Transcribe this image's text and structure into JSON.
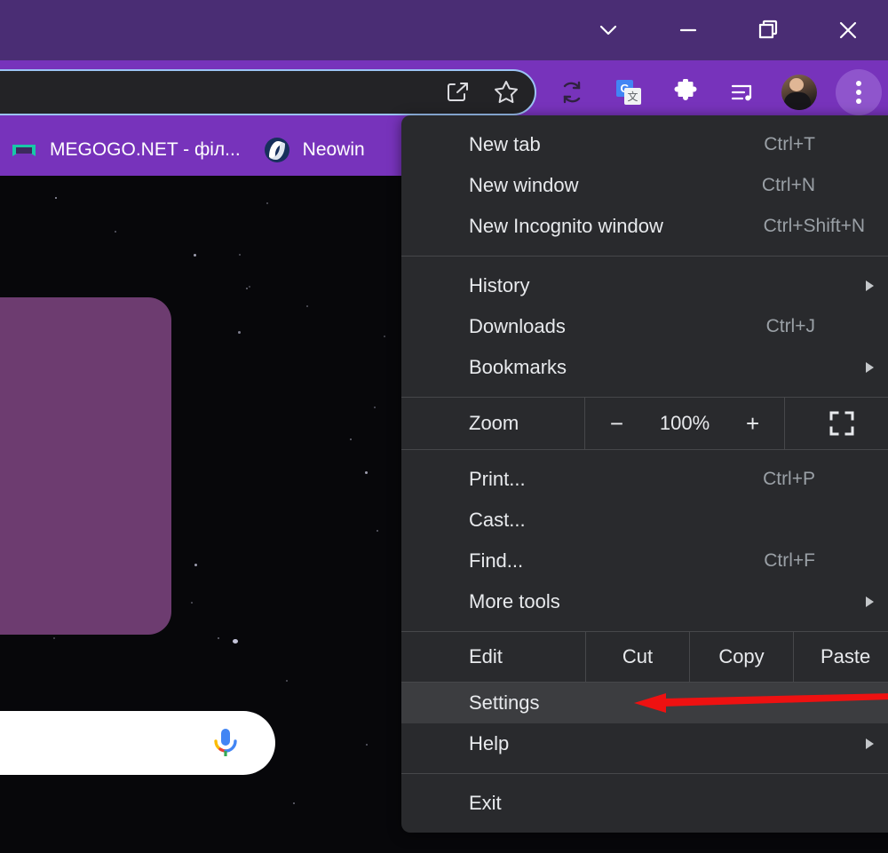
{
  "window": {
    "controls": [
      {
        "name": "chevron-down-icon",
        "label": "Minimize to tab search"
      },
      {
        "name": "minimize-icon",
        "label": "Minimize"
      },
      {
        "name": "restore-icon",
        "label": "Restore"
      },
      {
        "name": "close-icon",
        "label": "Close"
      }
    ],
    "titlebar_color": "#4a2d74",
    "toolbar_color": "#7733bb"
  },
  "toolbar": {
    "omnibox_icons": [
      "share-icon",
      "bookmark-star-icon"
    ],
    "actions": [
      {
        "name": "refresh-sync-icon",
        "label": "Sync"
      },
      {
        "name": "google-translate-icon",
        "label": "Translate"
      },
      {
        "name": "extensions-puzzle-icon",
        "label": "Extensions"
      },
      {
        "name": "media-playlist-icon",
        "label": "Media"
      },
      {
        "name": "avatar",
        "label": "Profile"
      },
      {
        "name": "three-dot-menu-icon",
        "label": "Customize and control Google Chrome"
      }
    ]
  },
  "bookmarks": {
    "items": [
      {
        "label": "MEGOGO.NET - філ...",
        "icon": "megogo-icon",
        "color": "#18c8a8"
      },
      {
        "label": "Neowin",
        "icon": "neowin-icon",
        "color": "#1b3a6b"
      }
    ]
  },
  "menu": {
    "sections": [
      {
        "items": [
          {
            "label": "New tab",
            "accel": "Ctrl+T",
            "submenu": false
          },
          {
            "label": "New window",
            "accel": "Ctrl+N",
            "submenu": false
          },
          {
            "label": "New Incognito window",
            "accel": "Ctrl+Shift+N",
            "submenu": false
          }
        ]
      },
      {
        "items": [
          {
            "label": "History",
            "accel": "",
            "submenu": true
          },
          {
            "label": "Downloads",
            "accel": "Ctrl+J",
            "submenu": false
          },
          {
            "label": "Bookmarks",
            "accel": "",
            "submenu": true
          }
        ]
      }
    ],
    "zoom_row": {
      "label": "Zoom",
      "minus": "−",
      "value": "100%",
      "plus": "+",
      "fullscreen_icon": "fullscreen-icon"
    },
    "tools_section": {
      "items": [
        {
          "label": "Print...",
          "accel": "Ctrl+P",
          "submenu": false
        },
        {
          "label": "Cast...",
          "accel": "",
          "submenu": false
        },
        {
          "label": "Find...",
          "accel": "Ctrl+F",
          "submenu": false
        },
        {
          "label": "More tools",
          "accel": "",
          "submenu": true
        }
      ]
    },
    "edit_row": {
      "label": "Edit",
      "cut": "Cut",
      "copy": "Copy",
      "paste": "Paste"
    },
    "settings_section": {
      "items": [
        {
          "label": "Settings",
          "accel": "",
          "submenu": false,
          "hovered": true
        },
        {
          "label": "Help",
          "accel": "",
          "submenu": true,
          "hovered": false
        }
      ]
    },
    "exit_section": {
      "items": [
        {
          "label": "Exit",
          "accel": "",
          "submenu": false
        }
      ]
    },
    "background": "#292a2d",
    "hover_background": "#3c3d40"
  },
  "annotation": {
    "arrow": {
      "name": "red-pointer-arrow",
      "color": "#ee1111",
      "points_to": "Settings"
    }
  },
  "page_content": {
    "doodle_card": {
      "name": "google-doodle-card",
      "color": "#6d3c70"
    },
    "heart_color": "#f8436d",
    "share_color": "#3b5cf5",
    "search_box": {
      "placeholder": "",
      "value": "",
      "mic_icon": "google-mic-icon"
    }
  }
}
